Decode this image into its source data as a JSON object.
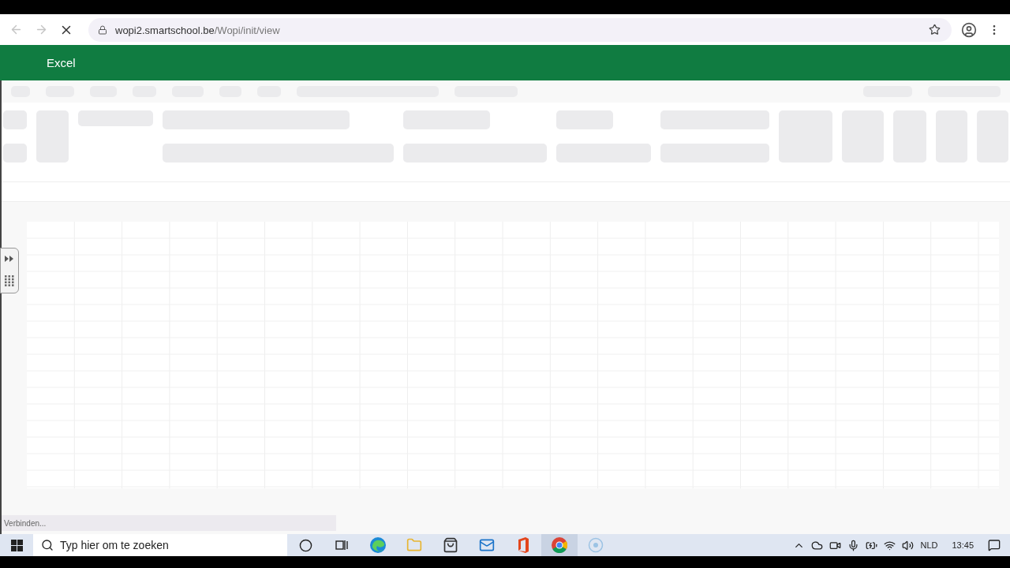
{
  "browser": {
    "url_host": "wopi2.smartschool.be",
    "url_path": "/Wopi/init/view",
    "loading": true
  },
  "app": {
    "title": "Excel"
  },
  "status": {
    "text": "Verbinden..."
  },
  "taskbar": {
    "search_placeholder": "Typ hier om te zoeken",
    "language": "NLD",
    "time": "13:45"
  }
}
